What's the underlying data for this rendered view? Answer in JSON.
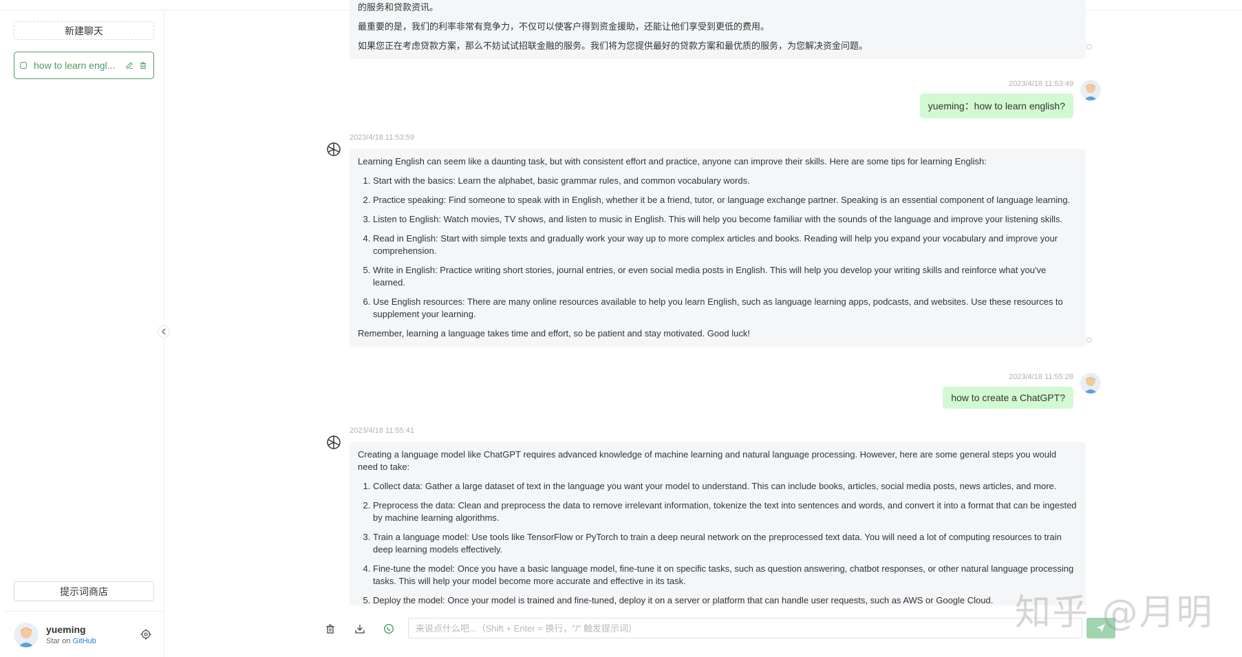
{
  "sidebar": {
    "new_chat_label": "新建聊天",
    "history": [
      {
        "title": "how to learn engl...",
        "icon": "chat-icon",
        "edit_icon": "edit-icon",
        "delete_icon": "trash-icon"
      }
    ],
    "prompt_store_label": "提示词商店",
    "user": {
      "name": "yueming",
      "sub_prefix": "Star on ",
      "sub_link": "GitHub"
    },
    "settings_icon": "gear-icon",
    "collapse_icon": "chevron-left-icon"
  },
  "messages": [
    {
      "role": "assistant",
      "paragraphs_top": [
        "的服务和贷款资讯。",
        "最重要的是，我们的利率非常有竞争力，不仅可以使客户得到资金援助，还能让他们享受到更低的费用。",
        "如果您正在考虑贷款方案，那么不妨试试招联金融的服务。我们将为您提供最好的贷款方案和最优质的服务，为您解决资金问题。"
      ]
    },
    {
      "role": "user",
      "time": "2023/4/18 11:53:49",
      "text": "yueming：how to learn english?"
    },
    {
      "role": "assistant",
      "time": "2023/4/18 11:53:59",
      "intro": "Learning English can seem like a daunting task, but with consistent effort and practice, anyone can improve their skills. Here are some tips for learning English:",
      "items": [
        "Start with the basics: Learn the alphabet, basic grammar rules, and common vocabulary words.",
        "Practice speaking: Find someone to speak with in English, whether it be a friend, tutor, or language exchange partner. Speaking is an essential component of language learning.",
        "Listen to English: Watch movies, TV shows, and listen to music in English. This will help you become familiar with the sounds of the language and improve your listening skills.",
        "Read in English: Start with simple texts and gradually work your way up to more complex articles and books. Reading will help you expand your vocabulary and improve your comprehension.",
        "Write in English: Practice writing short stories, journal entries, or even social media posts in English. This will help you develop your writing skills and reinforce what you've learned.",
        "Use English resources: There are many online resources available to help you learn English, such as language learning apps, podcasts, and websites. Use these resources to supplement your learning."
      ],
      "outro": "Remember, learning a language takes time and effort, so be patient and stay motivated. Good luck!"
    },
    {
      "role": "user",
      "time": "2023/4/18 11:55:28",
      "text": "how to create a ChatGPT?"
    },
    {
      "role": "assistant",
      "time": "2023/4/18 11:55:41",
      "intro": "Creating a language model like ChatGPT requires advanced knowledge of machine learning and natural language processing. However, here are some general steps you would need to take:",
      "items": [
        "Collect data: Gather a large dataset of text in the language you want your model to understand. This can include books, articles, social media posts, news articles, and more.",
        "Preprocess the data: Clean and preprocess the data to remove irrelevant information, tokenize the text into sentences and words, and convert it into a format that can be ingested by machine learning algorithms.",
        "Train a language model: Use tools like TensorFlow or PyTorch to train a deep neural network on the preprocessed text data. You will need a lot of computing resources to train deep learning models effectively.",
        "Fine-tune the model: Once you have a basic language model, fine-tune it on specific tasks, such as question answering, chatbot responses, or other natural language processing tasks. This will help your model become more accurate and effective in its task.",
        "Deploy the model: Once your model is trained and fine-tuned, deploy it on a server or platform that can handle user requests, such as AWS or Google Cloud."
      ]
    }
  ],
  "input_bar": {
    "placeholder": "来说点什么吧...（Shift + Enter = 换行，\"/\" 触发提示词）",
    "tools": [
      "trash-icon",
      "download-icon",
      "whatsapp-icon"
    ],
    "send_icon": "send-icon"
  },
  "watermark": "知乎 @月明",
  "colors": {
    "accent": "#4b9e5f",
    "user_bubble": "#d2f9d1",
    "ai_bubble": "#f4f6f8",
    "send_button": "#9fd6b0"
  }
}
